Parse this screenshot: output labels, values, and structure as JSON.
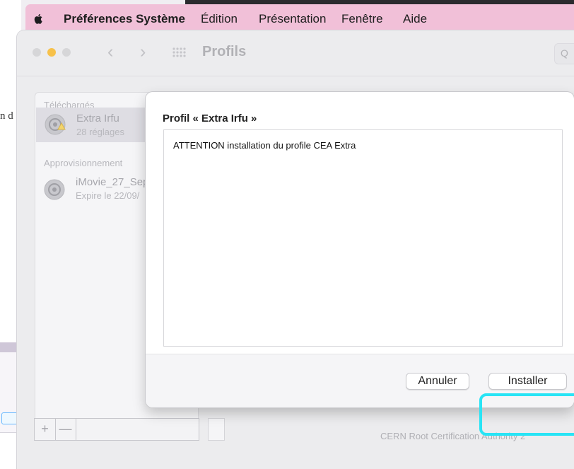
{
  "background": {
    "edge_text": "n d"
  },
  "menubar": {
    "app": "Préférences Système",
    "items": [
      "Édition",
      "Présentation",
      "Fenêtre",
      "Aide"
    ]
  },
  "window": {
    "title": "Profils",
    "search_glyph": "Q"
  },
  "sidebar": {
    "sections": [
      {
        "label": "Téléchargés",
        "items": [
          {
            "name": "Extra Irfu",
            "subtitle": "28 réglages"
          }
        ]
      },
      {
        "label": "Approvisionnement",
        "items": [
          {
            "name": "iMovie_27_Sep",
            "subtitle": "Expire le 22/09/"
          }
        ]
      }
    ]
  },
  "bottom": {
    "add": "+",
    "remove": "—"
  },
  "detail": {
    "cert_authority": "CERN Root Certification Authority 2"
  },
  "sheet": {
    "title": "Profil « Extra Irfu »",
    "description": "ATTENTION installation du profile CEA Extra",
    "buttons": {
      "cancel": "Annuler",
      "install": "Installer"
    }
  },
  "colors": {
    "menubar_bg": "#f1c0d8",
    "highlight": "#28e4f5",
    "window_bg": "#ececee"
  }
}
